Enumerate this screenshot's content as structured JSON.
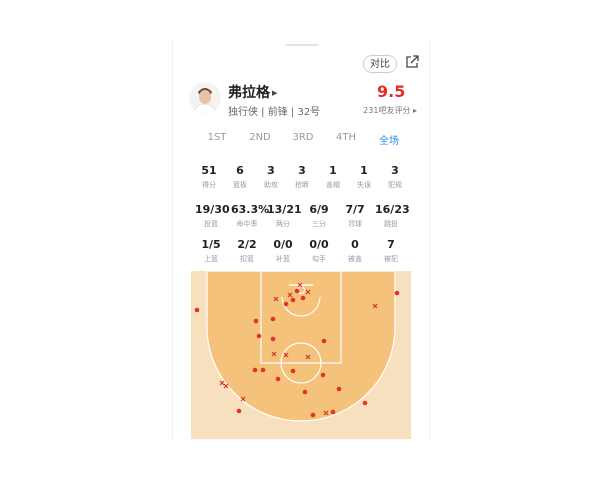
{
  "header": {
    "compare_label": "对比",
    "share_icon": "share-icon"
  },
  "player": {
    "name": "弗拉格",
    "avatar_icon": "player-avatar",
    "meta": "独行侠 | 前锋 | 32号",
    "rating": "9.5",
    "rating_sub": "231吧友评分 ▸"
  },
  "tabs": [
    {
      "label": "1ST",
      "active": false
    },
    {
      "label": "2ND",
      "active": false
    },
    {
      "label": "3RD",
      "active": false
    },
    {
      "label": "4TH",
      "active": false
    },
    {
      "label": "全场",
      "active": true
    }
  ],
  "stats": {
    "row1": [
      {
        "value": "51",
        "label": "得分"
      },
      {
        "value": "6",
        "label": "篮板"
      },
      {
        "value": "3",
        "label": "助攻"
      },
      {
        "value": "3",
        "label": "抢断"
      },
      {
        "value": "1",
        "label": "盖帽"
      },
      {
        "value": "1",
        "label": "失误"
      },
      {
        "value": "3",
        "label": "犯规"
      }
    ],
    "row2": [
      {
        "value": "19/30",
        "label": "投篮"
      },
      {
        "value": "63.3%",
        "label": "命中率"
      },
      {
        "value": "13/21",
        "label": "两分"
      },
      {
        "value": "6/9",
        "label": "三分"
      },
      {
        "value": "7/7",
        "label": "罚球"
      },
      {
        "value": "16/23",
        "label": "跳投"
      }
    ],
    "row3": [
      {
        "value": "1/5",
        "label": "上篮"
      },
      {
        "value": "2/2",
        "label": "扣篮"
      },
      {
        "value": "0/0",
        "label": "补篮"
      },
      {
        "value": "0/0",
        "label": "勾手"
      },
      {
        "value": "0",
        "label": "被盖"
      },
      {
        "value": "7",
        "label": "被犯"
      }
    ]
  },
  "colors": {
    "rating": "#e02d2d",
    "active_tab": "#2d8cdb",
    "court_outer": "#f7e0be",
    "court_paint": "#f4c27a",
    "court_lines": "#ffffff",
    "made_dot": "#e0342a",
    "miss_x": "#d8342a"
  }
}
